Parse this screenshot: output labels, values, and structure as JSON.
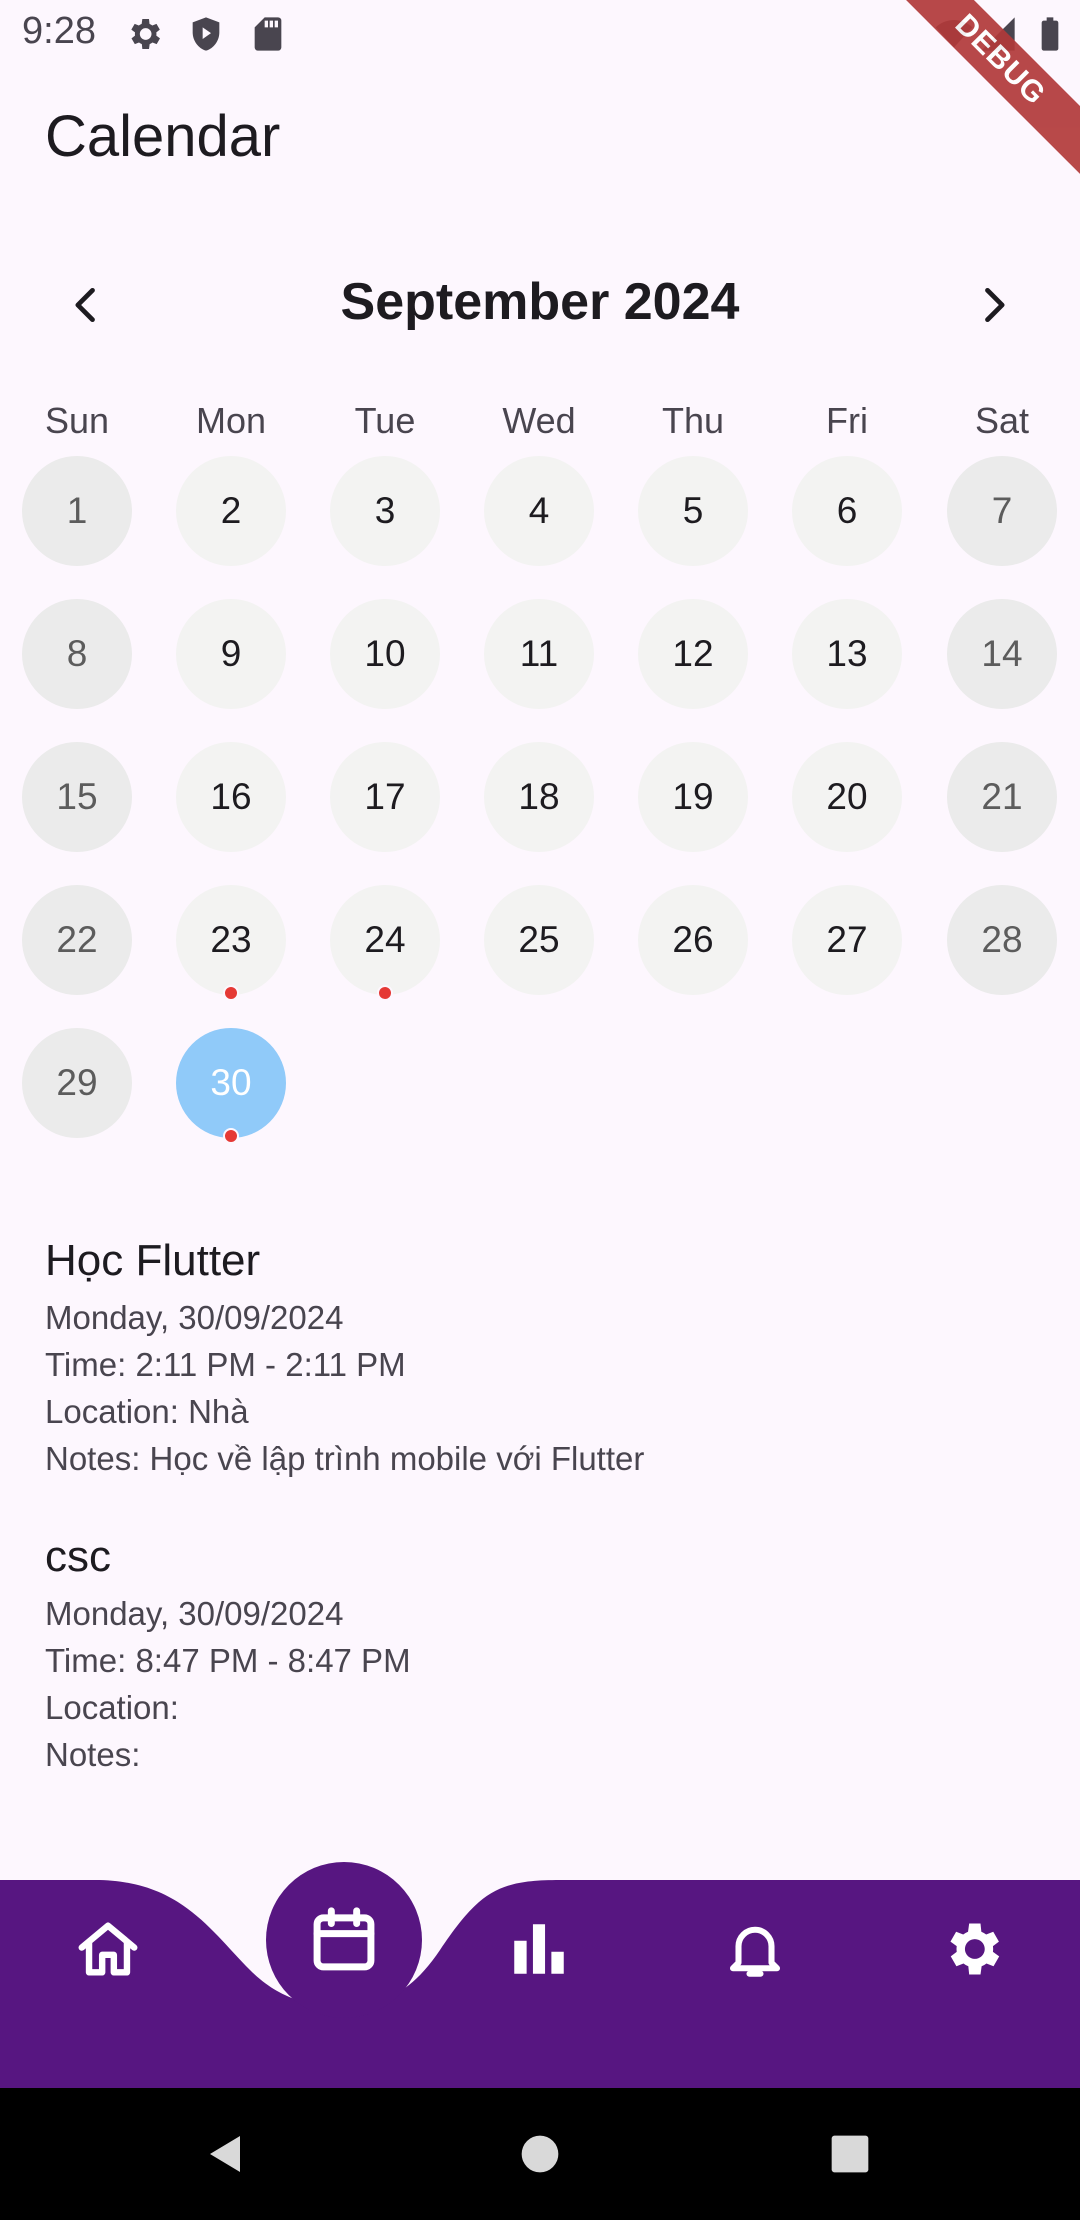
{
  "status_bar": {
    "time": "9:28",
    "left_icons": [
      "gear-icon",
      "shield-play-icon",
      "sd-card-icon"
    ],
    "right_icons": [
      "wifi-icon",
      "signal-icon",
      "battery-icon"
    ],
    "debug_banner": "DEBUG"
  },
  "header": {
    "title": "Calendar"
  },
  "calendar": {
    "month_label": "September 2024",
    "prev_icon": "chevron-left-icon",
    "next_icon": "chevron-right-icon",
    "weekdays": [
      "Sun",
      "Mon",
      "Tue",
      "Wed",
      "Thu",
      "Fri",
      "Sat"
    ],
    "first_weekday_index": 0,
    "days": [
      "1",
      "2",
      "3",
      "4",
      "5",
      "6",
      "7",
      "8",
      "9",
      "10",
      "11",
      "12",
      "13",
      "14",
      "15",
      "16",
      "17",
      "18",
      "19",
      "20",
      "21",
      "22",
      "23",
      "24",
      "25",
      "26",
      "27",
      "28",
      "29",
      "30"
    ],
    "selected_day": "30",
    "days_with_events": [
      "23",
      "24",
      "30"
    ]
  },
  "events": [
    {
      "title": "Học Flutter",
      "date": "Monday, 30/09/2024",
      "time": "Time: 2:11 PM - 2:11 PM",
      "location": "Location: Nhà",
      "notes": "Notes: Học về lập trình mobile với Flutter"
    },
    {
      "title": "csc",
      "date": "Monday, 30/09/2024",
      "time": "Time: 8:47 PM - 8:47 PM",
      "location": "Location:",
      "notes": "Notes:"
    }
  ],
  "bottom_nav": {
    "items": [
      "home-icon",
      "calendar-icon",
      "bar-chart-icon",
      "bell-icon",
      "settings-icon"
    ],
    "active": "calendar-icon",
    "color": "#571681"
  },
  "system_nav": [
    "back-icon",
    "home-circle-icon",
    "recents-icon"
  ],
  "colors": {
    "background": "#fdf7fe",
    "selected_day": "#90caf9",
    "event_dot": "#e53935",
    "nav_bar": "#571681"
  }
}
